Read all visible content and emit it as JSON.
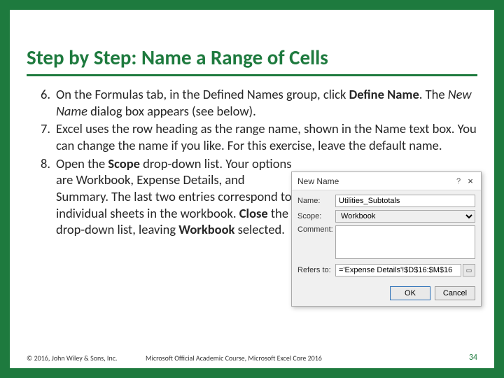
{
  "title": "Step by Step: Name a Range of Cells",
  "steps": {
    "s6": {
      "num": "6.",
      "t1": "On the Formulas tab, in the Defined Names group, click ",
      "bold1": "Define Name",
      "t2": ". The ",
      "italic1": "New Name",
      "t3": " dialog box appears (see below)."
    },
    "s7": {
      "num": "7.",
      "t1": "Excel uses the row heading as the range name, shown in the Name text box. You can change the name if you like. For this exercise, leave the default name."
    },
    "s8": {
      "num": "8.",
      "t1": "Open the ",
      "bold1": "Scope",
      "t2": " drop-down list. Your options are Workbook, Expense Details, and Summary. The last two entries correspond to individual sheets in the workbook. ",
      "bold2": "Close",
      "t3": " the drop-down list, leaving ",
      "bold3": "Workbook",
      "t4": " selected."
    }
  },
  "dialog": {
    "title": "New Name",
    "help": "?",
    "close": "×",
    "name_label": "Name:",
    "name_value": "Utilities_Subtotals",
    "scope_label": "Scope:",
    "scope_value": "Workbook",
    "comment_label": "Comment:",
    "comment_value": "",
    "refers_label": "Refers to:",
    "refers_value": "='Expense Details'!$D$16:$M$16",
    "ok": "OK",
    "cancel": "Cancel",
    "pick": "▭"
  },
  "footer": {
    "copyright": "© 2016, John Wiley & Sons, Inc.",
    "course": "Microsoft Official Academic Course, Microsoft Excel Core 2016",
    "page": "34"
  }
}
